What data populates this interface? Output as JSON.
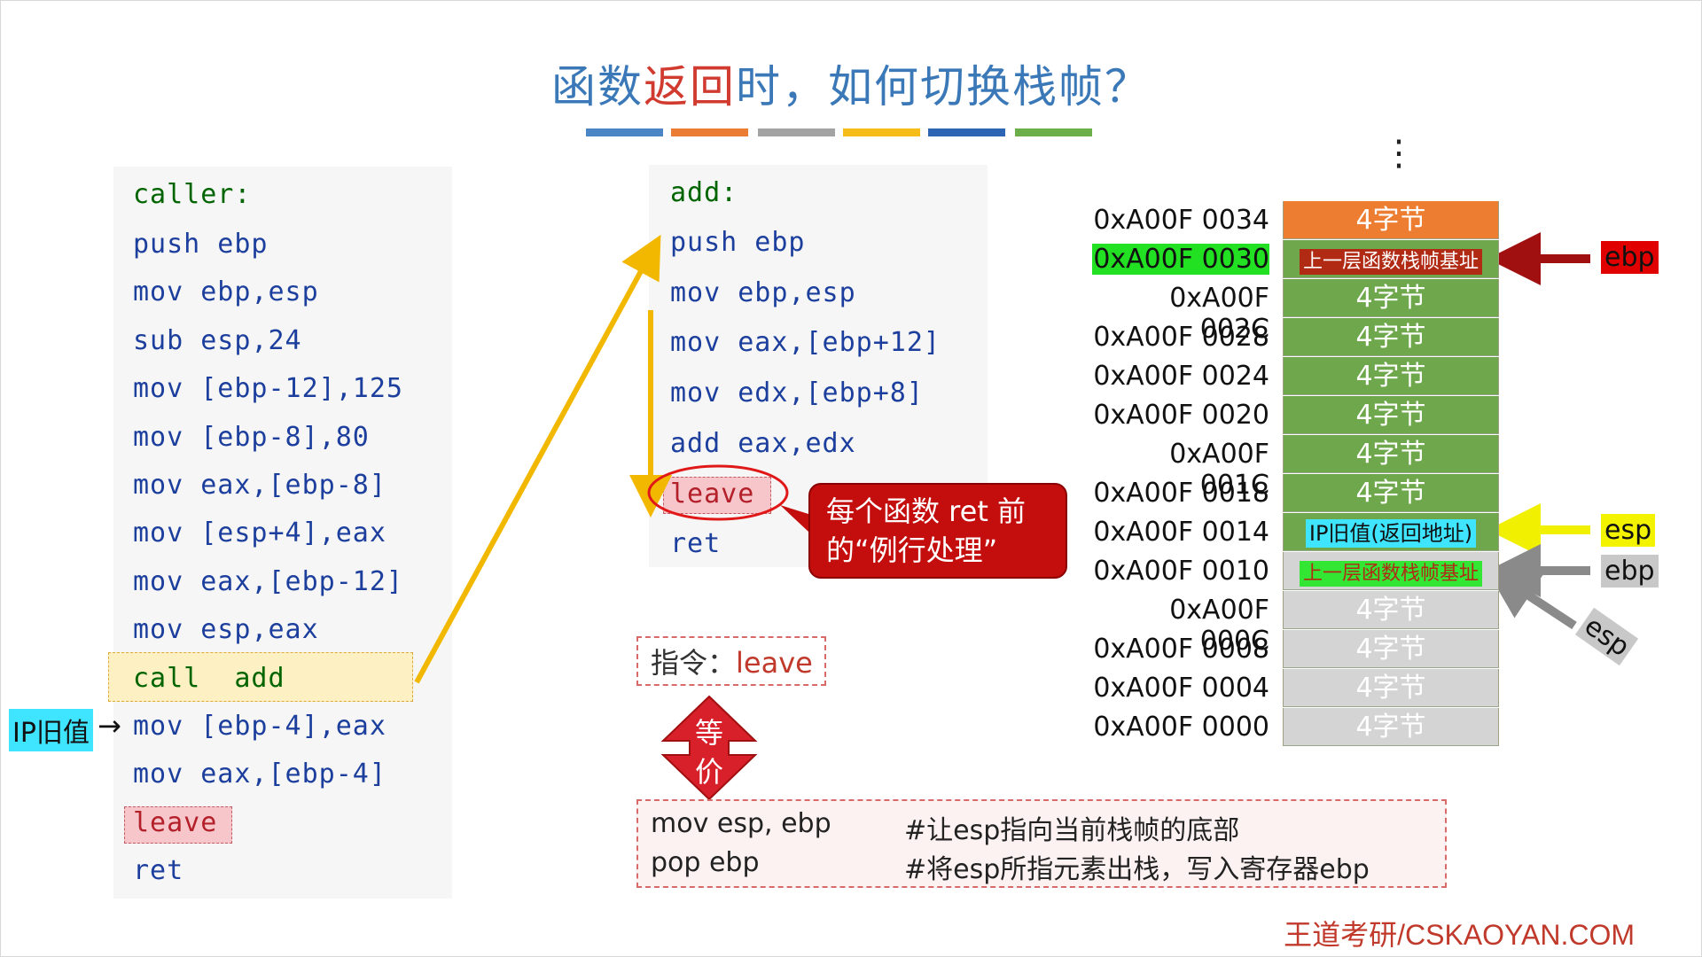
{
  "title": {
    "part1": "函数",
    "part2": "返回",
    "part3": "时，如何切换栈帧？"
  },
  "colors": {
    "title": "#3a78b8",
    "highlight": "#d13a2f",
    "bar": [
      "#4a86c5",
      "#ea7d33",
      "#a3a3a3",
      "#f6bd19",
      "#2d64b4",
      "#6cae4a"
    ]
  },
  "caller": {
    "label": "caller:",
    "lines": [
      "push ebp",
      "mov ebp,esp",
      "sub esp,24",
      "mov [ebp-12],125",
      "mov [ebp-8],80",
      "mov eax,[ebp-8]",
      "mov [esp+4],eax",
      "mov eax,[ebp-12]",
      "mov esp,eax",
      "call  add",
      "mov [ebp-4],eax",
      "mov eax,[ebp-4]",
      "leave",
      "ret"
    ],
    "ip_tag": "IP旧值"
  },
  "add": {
    "label": "add:",
    "lines": [
      "push ebp",
      "mov ebp,esp",
      "mov eax,[ebp+12]",
      "mov edx,[ebp+8]",
      "add eax,edx",
      "leave",
      "ret"
    ]
  },
  "callout": {
    "line1": "每个函数 ret 前",
    "line2": "的“例行处理”"
  },
  "instruction": {
    "label": "指令：",
    "value": "leave"
  },
  "equiv": {
    "arrow_top": "等",
    "arrow_bottom": "价",
    "rows": [
      {
        "code": "mov esp, ebp",
        "comment": "#让esp指向当前栈帧的底部"
      },
      {
        "code": "pop ebp",
        "comment": "#将esp所指元素出栈，写入寄存器ebp"
      }
    ]
  },
  "stack": {
    "dots": "⋮",
    "rows": [
      {
        "addr": "0xA00F 0034",
        "cell": "4字节"
      },
      {
        "addr": "0xA00F 0030",
        "cell": "上一层函数栈帧基址"
      },
      {
        "addr": "0xA00F 002C",
        "cell": "4字节"
      },
      {
        "addr": "0xA00F 0028",
        "cell": "4字节"
      },
      {
        "addr": "0xA00F 0024",
        "cell": "4字节"
      },
      {
        "addr": "0xA00F 0020",
        "cell": "4字节"
      },
      {
        "addr": "0xA00F 001C",
        "cell": "4字节"
      },
      {
        "addr": "0xA00F 0018",
        "cell": "4字节"
      },
      {
        "addr": "0xA00F 0014",
        "cell": "IP旧值(返回地址)"
      },
      {
        "addr": "0xA00F 0010",
        "cell": "上一层函数栈帧基址"
      },
      {
        "addr": "0xA00F 000C",
        "cell": "4字节"
      },
      {
        "addr": "0xA00F 0008",
        "cell": "4字节"
      },
      {
        "addr": "0xA00F 0004",
        "cell": "4字节"
      },
      {
        "addr": "0xA00F 0000",
        "cell": "4字节"
      }
    ],
    "registers": {
      "ebp_top": "ebp",
      "esp": "esp",
      "ebp_mid": "ebp",
      "esp_old": "esp"
    }
  },
  "footer": "王道考研/CSKAOYAN.COM"
}
